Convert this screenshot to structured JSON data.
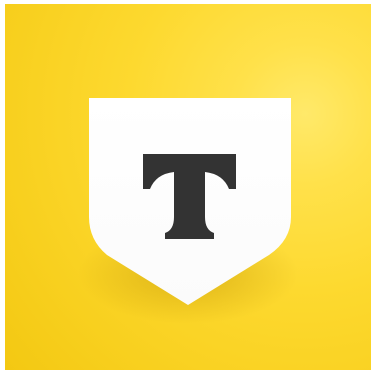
{
  "app": {
    "logo_letter": "T",
    "icon": "bank-shield-logo-icon"
  },
  "colors": {
    "background": "#f8d01f",
    "background_highlight": "#ffe96a",
    "shield": "#ffffff",
    "letter": "#333333"
  }
}
